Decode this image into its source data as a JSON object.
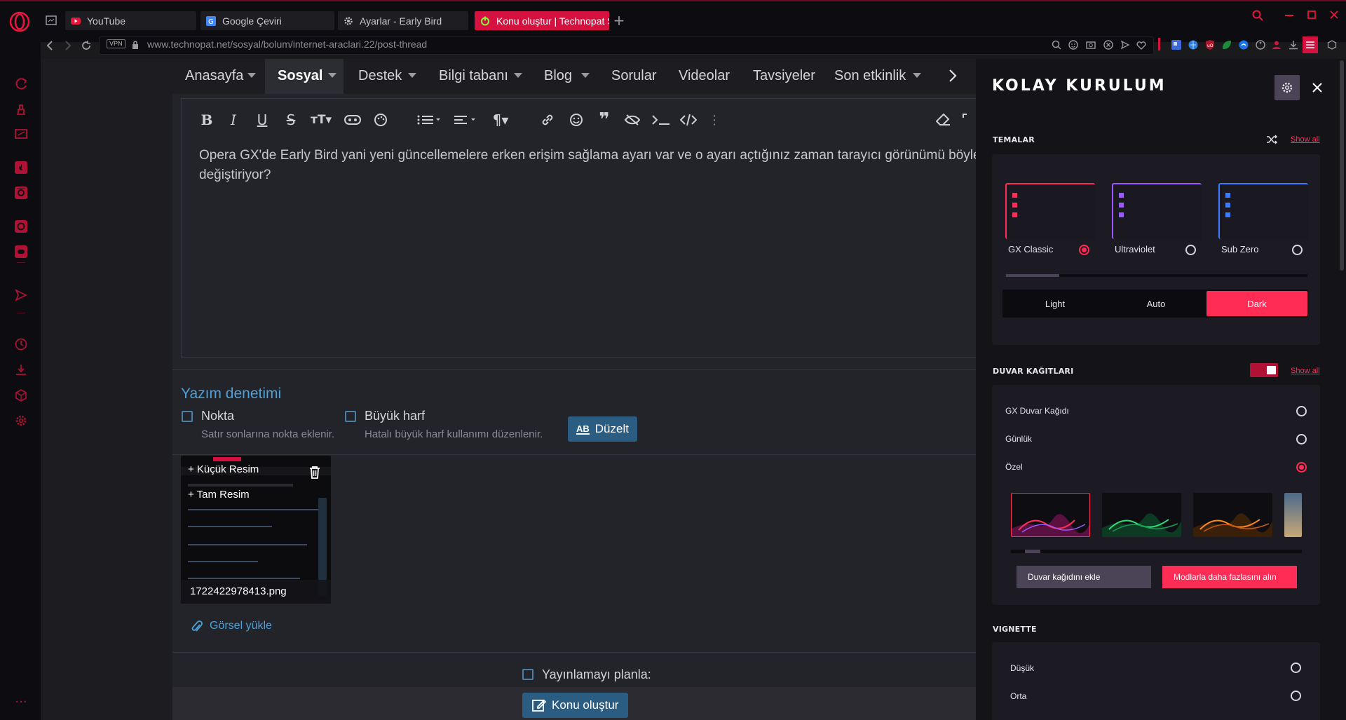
{
  "browser": {
    "tabs": [
      {
        "label": "YouTube"
      },
      {
        "label": "Google Çeviri"
      },
      {
        "label": "Ayarlar - Early Bird"
      },
      {
        "label": "Konu oluştur | Technopat S"
      }
    ],
    "vpn_label": "VPN",
    "url": "www.technopat.net/sosyal/bolum/internet-araclari.22/post-thread"
  },
  "nav": {
    "items": [
      "Anasayfa",
      "Sosyal",
      "Destek",
      "Bilgi tabanı",
      "Blog",
      "Sorular",
      "Videolar",
      "Tavsiyeler",
      "Son etkinlik"
    ]
  },
  "editor": {
    "text_line1": "Opera GX'de Early Bird yani yeni güncellemelere erken erişim sağlama ayarı var ve o ayarı açtığınız zaman tarayıcı görünümü böyle oluy",
    "text_line2": "değiştiriyor?"
  },
  "spellcheck": {
    "title": "Yazım denetimi",
    "period_label": "Nokta",
    "period_hint": "Satır sonlarına nokta eklenir.",
    "caps_label": "Büyük harf",
    "caps_hint": "Hatalı büyük harf kullanımı düzenlenir.",
    "fix_button": "Düzelt",
    "fix_icon_text": "AB"
  },
  "attachment": {
    "thumb_action": "+ Küçük Resim",
    "full_action": "+ Tam Resim",
    "filename": "1722422978413.png",
    "upload_label": "Görsel yükle"
  },
  "schedule_label": "Yayınlamayı planla:",
  "submit_button": "Konu oluştur",
  "panel": {
    "title": "KOLAY KURULUM",
    "themes_heading": "TEMALAR",
    "show_all": "Show all",
    "themes": [
      {
        "name": "GX Classic",
        "selected": true,
        "accent": "#ff2d55"
      },
      {
        "name": "Ultraviolet",
        "selected": false,
        "accent": "#9b59ff"
      },
      {
        "name": "Sub Zero",
        "selected": false,
        "accent": "#3b7bff"
      }
    ],
    "modes": [
      "Light",
      "Auto",
      "Dark"
    ],
    "active_mode": "Dark",
    "wallpapers_heading": "DUVAR KAĞITLARI",
    "wallpaper_toggle_on": true,
    "wallpaper_options": [
      {
        "name": "GX Duvar Kağıdı",
        "selected": false
      },
      {
        "name": "Günlük",
        "selected": false
      },
      {
        "name": "Özel",
        "selected": true
      }
    ],
    "add_wallpaper": "Duvar kağıdını ekle",
    "get_more": "Modlarla daha fazlasını alın",
    "vignette_heading": "VIGNETTE",
    "vignette_options": [
      {
        "name": "Düşük",
        "selected": false
      },
      {
        "name": "Orta",
        "selected": false
      }
    ]
  },
  "colors": {
    "accent": "#ff2d55",
    "link_blue": "#4ea0d8",
    "button_blue": "#2b5d82"
  }
}
